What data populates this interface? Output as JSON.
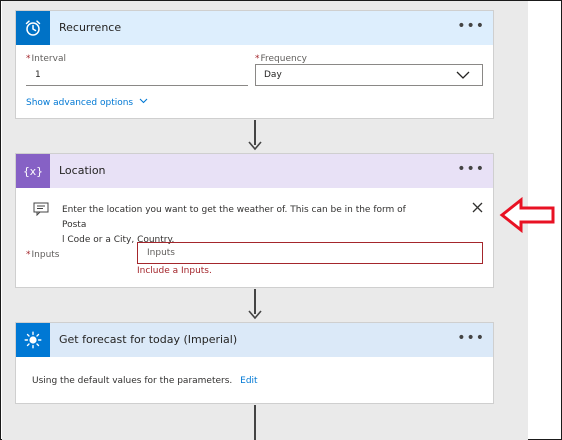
{
  "recurrence": {
    "title": "Recurrence",
    "more": "•••",
    "interval_label": "Interval",
    "interval_value": "1",
    "frequency_label": "Frequency",
    "frequency_value": "Day",
    "advanced_label": "Show advanced options",
    "accent": "#0072c6",
    "header_bg": "#ddeefd"
  },
  "location": {
    "title": "Location",
    "more": "•••",
    "info_line1": "Enter the location you want to get the weather of. This can be in the form of Posta",
    "info_line2": "l Code or a City, Country.",
    "inputs_label": "Inputs",
    "inputs_placeholder": "Inputs",
    "inputs_error": "Include a Inputs.",
    "accent": "#8661c5",
    "header_bg": "#e8e1f6"
  },
  "forecast": {
    "title": "Get forecast for today (Imperial)",
    "more": "•••",
    "defaults_text": "Using the default values for the parameters.",
    "edit_label": "Edit",
    "accent": "#0078d4",
    "header_bg": "#dbe9f8"
  },
  "colors": {
    "required": "#a4262c",
    "error_border": "#a4262c",
    "link": "#0078d4",
    "callout_arrow": "#e81123"
  },
  "icons": {
    "recurrence": "alarm-clock-icon",
    "location": "variable-braces-icon",
    "forecast": "sun-icon",
    "more": "ellipsis-icon",
    "dismiss": "close-icon",
    "message": "comment-icon",
    "chevron": "chevron-down-icon",
    "callout": "arrow-left-icon"
  }
}
